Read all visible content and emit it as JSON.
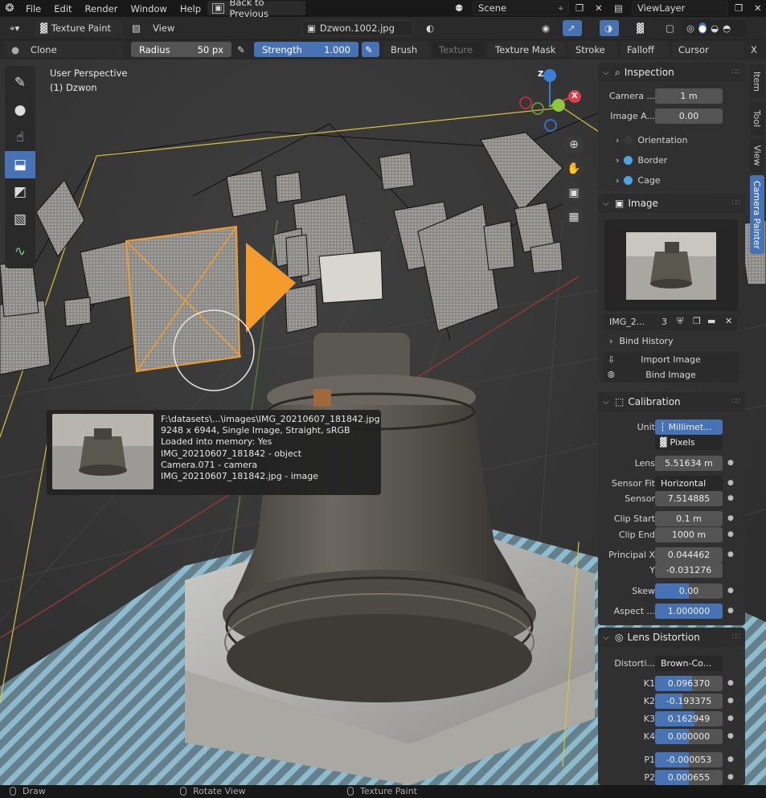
{
  "menubar": {
    "items": [
      "File",
      "Edit",
      "Render",
      "Window",
      "Help"
    ],
    "back_label": "Back to Previous",
    "scene_label": "Scene",
    "viewlayer_label": "ViewLayer"
  },
  "header": {
    "mode_label": "Texture Paint",
    "view_label": "View",
    "image_label": "Dzwon.1002.jpg"
  },
  "tool_header": {
    "brush_name": "Clone",
    "radius_label": "Radius",
    "radius_value": "50 px",
    "strength_label": "Strength",
    "strength_value": "1.000",
    "strength_fraction": 1.0,
    "menus": [
      "Brush",
      "Texture",
      "Texture Mask",
      "Stroke",
      "Falloff",
      "Cursor"
    ],
    "close": "X"
  },
  "viewport": {
    "perspective": "User Perspective",
    "object": "(1) Dzwon"
  },
  "gizmo": {
    "z": "Z",
    "x": "X"
  },
  "toolbar": {
    "tools": [
      "draw-brush-icon",
      "soften-icon",
      "smear-icon",
      "clone-icon",
      "fill-icon",
      "mask-icon",
      "annotate-icon"
    ],
    "active": "clone-icon"
  },
  "tooltip": {
    "lines": [
      "F:\\datasets\\...\\images\\IMG_20210607_181842.jpg",
      "9248 x 6944, Single Image, Straight, sRGB",
      "Loaded into memory: Yes",
      "IMG_20210607_181842 - object",
      "Camera.071 - camera",
      "IMG_20210607_181842.jpg - image"
    ]
  },
  "inspection": {
    "title": "Inspection",
    "camera_label": "Camera ...",
    "camera_value": "1 m",
    "image_alpha_label": "Image A...",
    "image_alpha_value": "0.00",
    "orientation_label": "Orientation",
    "border_label": "Border",
    "cage_label": "Cage",
    "accent_color": "#4fa3e0"
  },
  "image_panel": {
    "title": "Image",
    "image_name": "IMG_2...",
    "users": "3",
    "bind_history": "Bind History",
    "import_label": "Import Image",
    "bind_label": "Bind Image"
  },
  "calibration": {
    "title": "Calibration",
    "unit_label": "Unit",
    "unit_millimeters": "Millimet...",
    "unit_pixels": "Pixels",
    "lens_label": "Lens",
    "lens_value": "5.51634 m",
    "sensor_fit_label": "Sensor Fit",
    "sensor_fit_value": "Horizontal",
    "sensor_label": "Sensor",
    "sensor_value": "7.514885",
    "clip_start_label": "Clip Start",
    "clip_start_value": "0.1 m",
    "clip_end_label": "Clip End",
    "clip_end_value": "1000 m",
    "principal_x_label": "Principal X",
    "principal_x_value": "0.044462",
    "principal_y_label": "Y",
    "principal_y_value": "-0.031276",
    "skew_label": "Skew",
    "skew_value": "0.00",
    "skew_fraction": 0.5,
    "aspect_label": "Aspect ...",
    "aspect_value": "1.000000",
    "aspect_fraction": 1.0
  },
  "lens_distortion": {
    "title": "Lens Distortion",
    "distortion_label": "Distorti...",
    "distortion_value": "Brown-Co...",
    "rows": [
      {
        "label": "K1",
        "value": "0.096370",
        "fraction": 0.55
      },
      {
        "label": "K2",
        "value": "-0.193375",
        "fraction": 0.4
      },
      {
        "label": "K3",
        "value": "0.162949",
        "fraction": 0.58
      },
      {
        "label": "K4",
        "value": "0.000000",
        "fraction": 0.5
      }
    ],
    "p_rows": [
      {
        "label": "P1",
        "value": "-0.000053",
        "fraction": 0.5
      },
      {
        "label": "P2",
        "value": "0.000655",
        "fraction": 0.5
      }
    ]
  },
  "side_tabs": [
    "Item",
    "Tool",
    "View",
    "Camera Painter"
  ],
  "statusbar": {
    "draw": "Draw",
    "rotate": "Rotate View",
    "texture_paint": "Texture Paint"
  },
  "colors": {
    "accent_blue": "#4772b3",
    "selection_orange": "#f39c2c",
    "axis_x": "#d8404d",
    "axis_y": "#8ec73a",
    "axis_z": "#3a7fd5"
  }
}
